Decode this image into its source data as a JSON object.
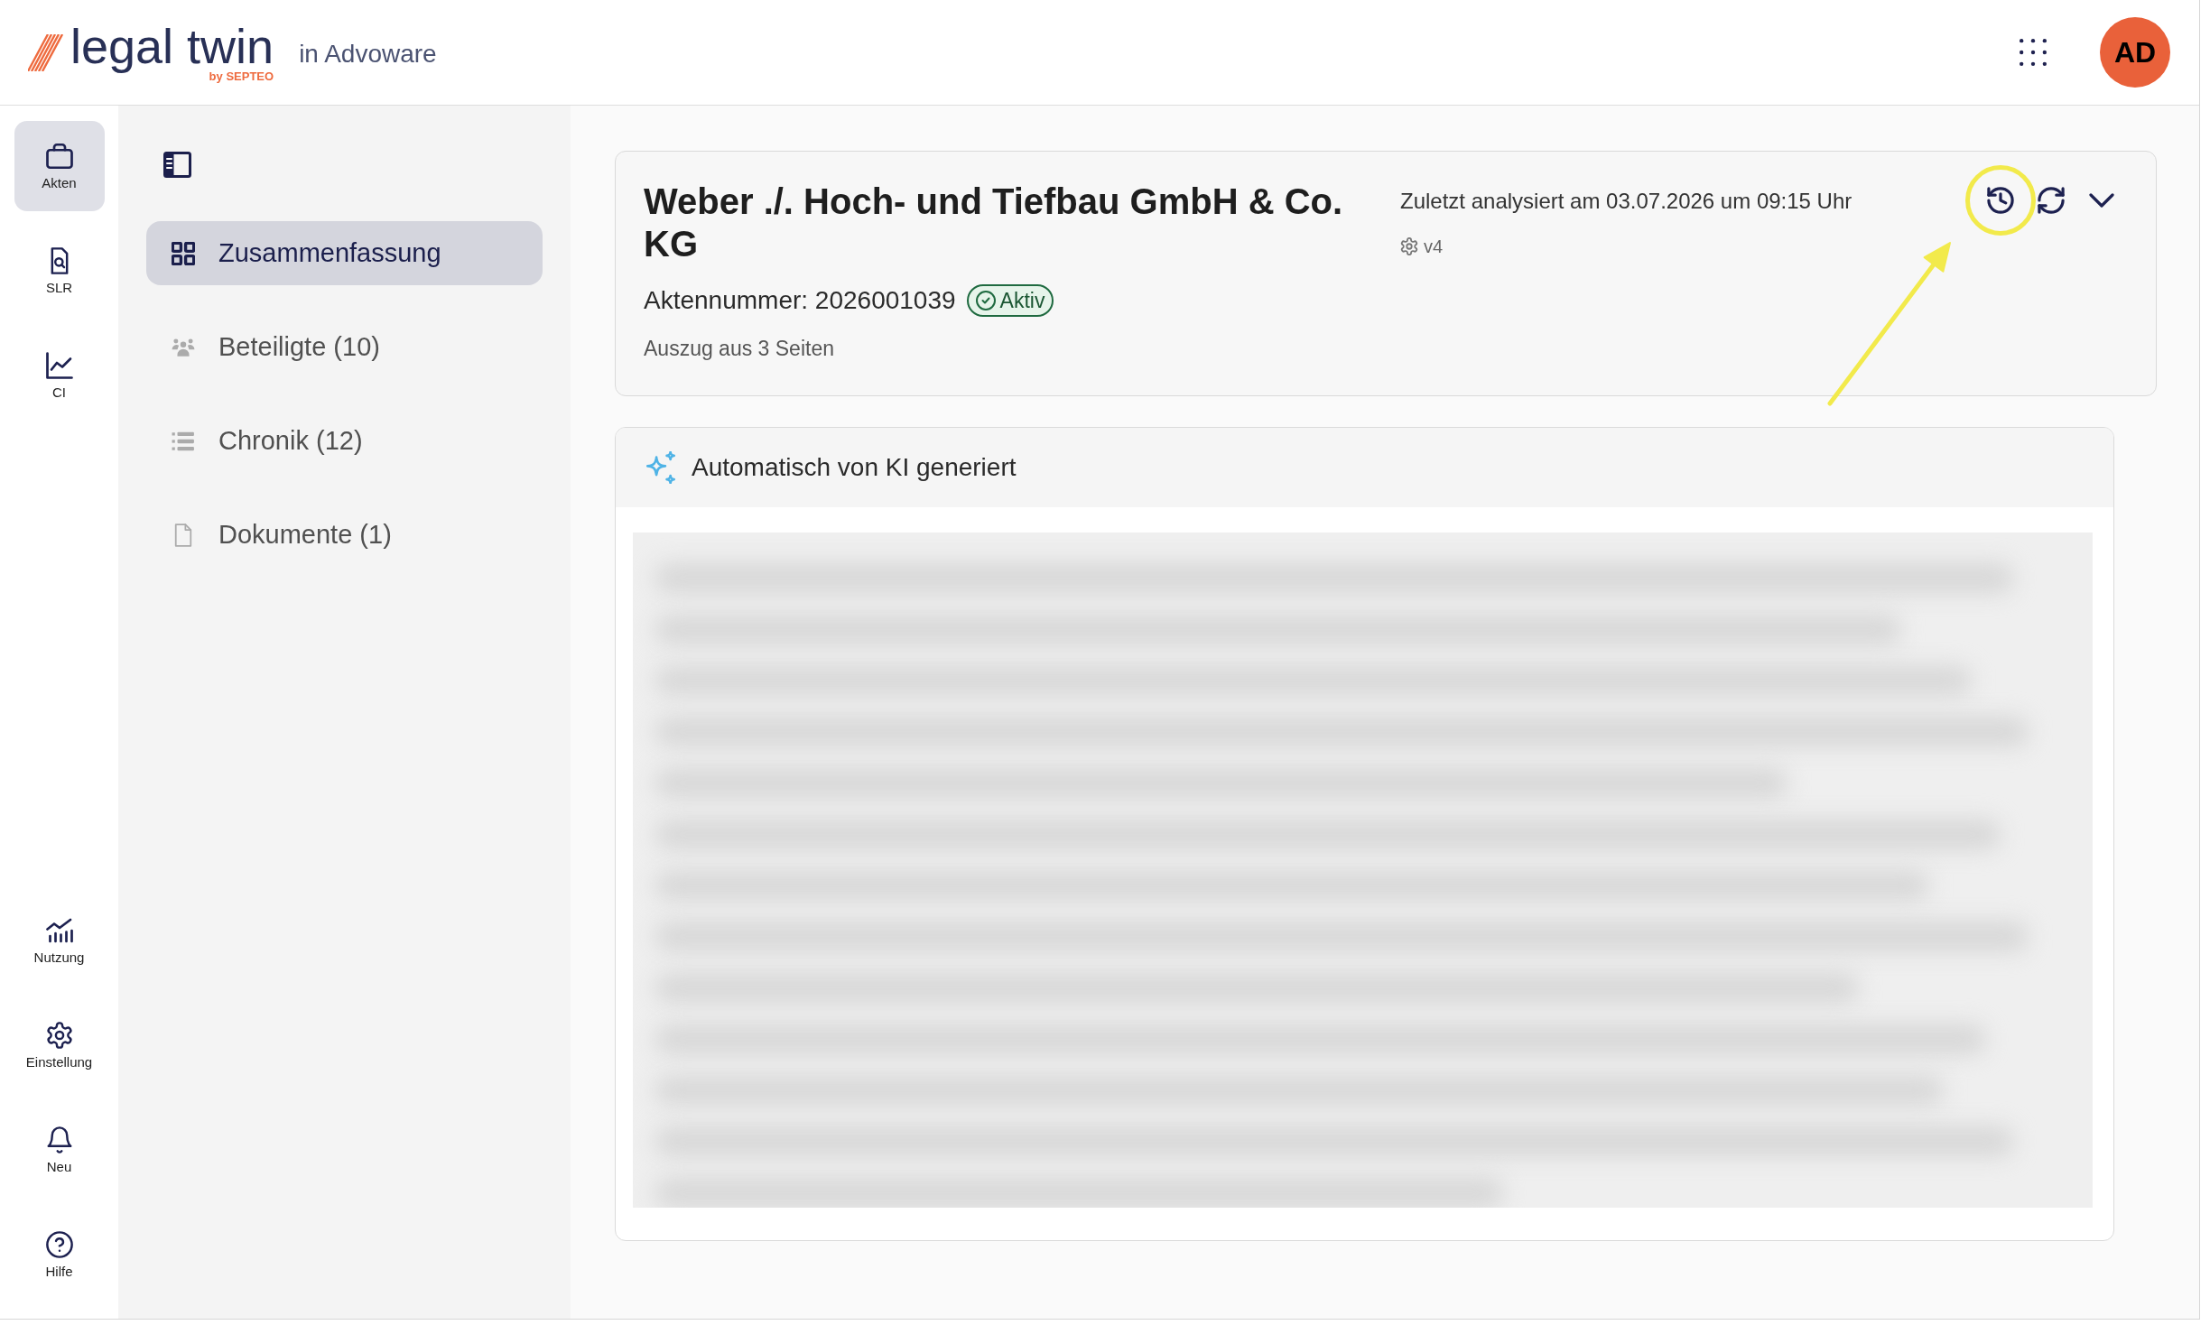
{
  "topbar": {
    "logo_name": "legal twin",
    "logo_byline": "by SEPTEO",
    "context": "in Advoware",
    "avatar": "AD"
  },
  "rail": {
    "top_items": [
      {
        "label": "Akten",
        "selected": true
      },
      {
        "label": "SLR",
        "selected": false
      },
      {
        "label": "CI",
        "selected": false
      }
    ],
    "bottom_items": [
      {
        "label": "Nutzung",
        "selected": false
      },
      {
        "label": "Einstellung",
        "selected": false
      },
      {
        "label": "Neu",
        "selected": false
      },
      {
        "label": "Hilfe",
        "selected": false
      }
    ]
  },
  "sidebar": {
    "items": [
      {
        "label": "Zusammenfassung",
        "selected": true
      },
      {
        "label": "Beteiligte (10)",
        "selected": false
      },
      {
        "label": "Chronik (12)",
        "selected": false
      },
      {
        "label": "Dokumente (1)",
        "selected": false
      }
    ]
  },
  "case_card": {
    "title": "Weber ./. Hoch- und Tiefbau GmbH & Co. KG",
    "file_number": "Aktennummer: 2026001039",
    "status": "Aktiv",
    "excerpt": "Auszug aus 3 Seiten",
    "last_analyzed": "Zuletzt analysiert am 03.07.2026 um 09:15 Uhr",
    "version": "v4",
    "actions": [
      {
        "highlighted": true
      },
      {
        "highlighted": false
      },
      {
        "highlighted": false
      }
    ]
  },
  "ai_card": {
    "heading": "Automatisch von KI generiert"
  }
}
